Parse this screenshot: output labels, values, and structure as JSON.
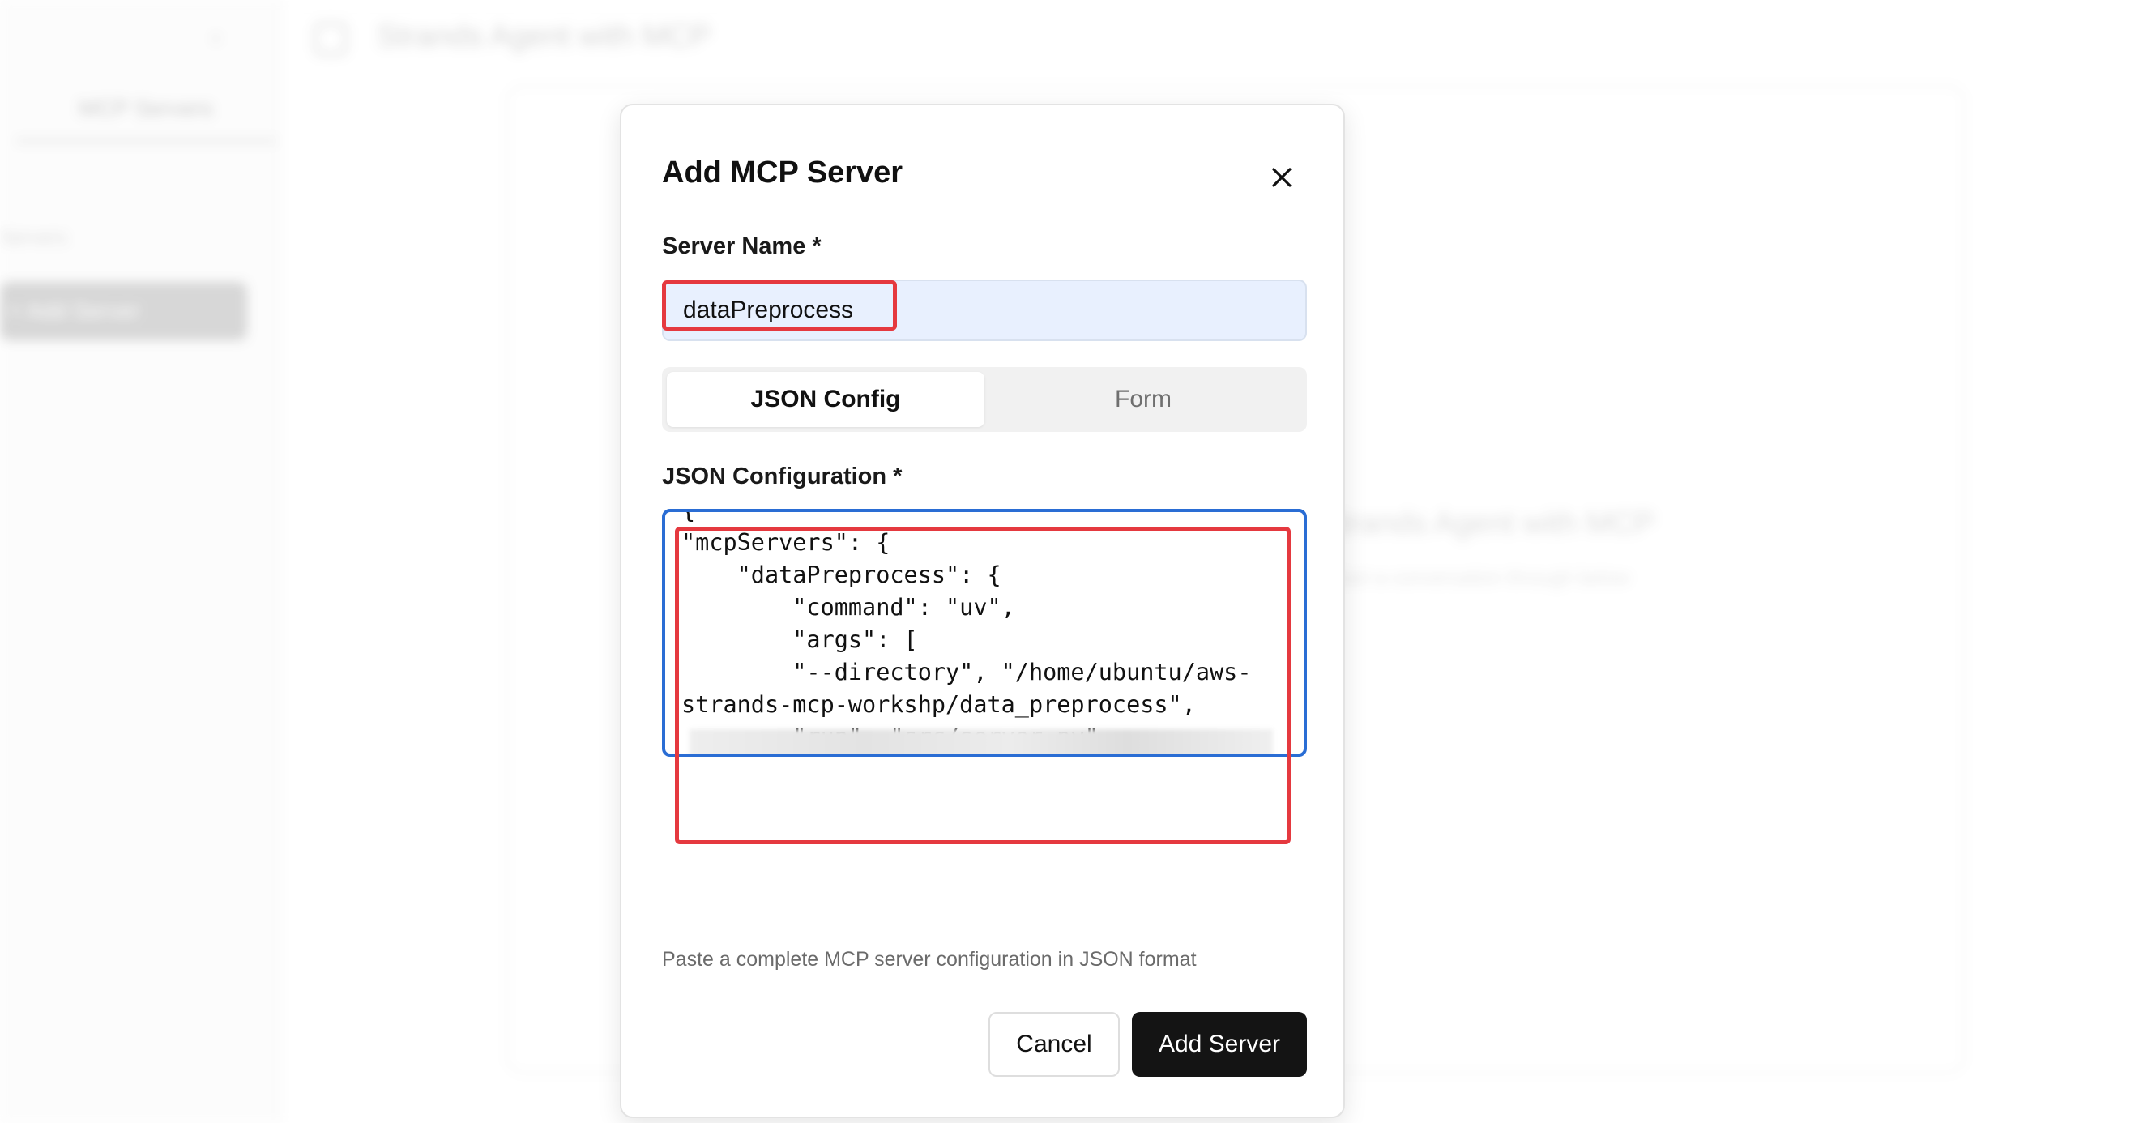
{
  "background": {
    "sidebar_toggle": "‹",
    "sidebar_tab": "MCP Servers",
    "sidebar_section": "Servers",
    "sidebar_button": "+ Add Server",
    "app_title": "Strands Agent with MCP",
    "welcome_title": "Strands Agent with MCP",
    "welcome_subtitle": "Start a conversation through below"
  },
  "modal": {
    "title": "Add MCP Server",
    "close_icon": "×",
    "server_name_label": "Server Name *",
    "server_name_value": "dataPreprocess",
    "tabs": [
      {
        "label": "JSON Config",
        "active": true
      },
      {
        "label": "Form",
        "active": false
      }
    ],
    "json_label": "JSON Configuration *",
    "json_value": "{\n\"mcpServers\": {\n    \"dataPreprocess\": {\n        \"command\": \"uv\",\n        \"args\": [\n        \"--directory\", \"/home/ubuntu/aws-\nstrands-mcp-workshp/data_preprocess\",\n        \"run\", \"src/server.py\"\n        ],\n        \"env\": {\n            \"SILICONFLOW_API_KEY\":\"sk-",
    "helper_text": "Paste a complete MCP server configuration in JSON format",
    "cancel_label": "Cancel",
    "submit_label": "Add Server"
  },
  "colors": {
    "accent_border": "#2a6dd4",
    "highlight": "#e5393f",
    "primary_button": "#141414",
    "input_autofill": "#e8f0fe"
  }
}
